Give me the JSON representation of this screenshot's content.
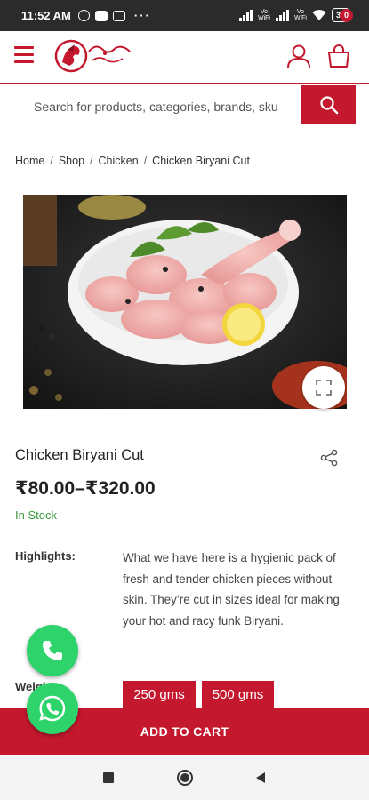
{
  "status_bar": {
    "time": "11:52 AM",
    "dots": "···",
    "volte1": "Vo\nWiFi",
    "volte2": "Vo\nWiFi",
    "battery": "38"
  },
  "header": {
    "logo_alt": "store-logo",
    "cart_count": "0"
  },
  "search": {
    "placeholder": "Search for products, categories, brands, sku"
  },
  "breadcrumb": {
    "items": [
      "Home",
      "Shop",
      "Chicken",
      "Chicken Biryani Cut"
    ],
    "separator": "/"
  },
  "product": {
    "title": "Chicken Biryani Cut",
    "price": "₹80.00–₹320.00",
    "stock": "In Stock",
    "highlights_label": "Highlights:",
    "highlights_text": "What we have here is a hygienic pack of fresh and tender chicken pieces without skin. They’re cut in sizes ideal for making your hot and racy funk Biryani.",
    "weight_label": "Weight",
    "weights": [
      "250 gms",
      "500 gms"
    ],
    "add_to_cart": "ADD TO CART"
  },
  "colors": {
    "brand": "#c4182f",
    "in_stock": "#3b9b3b",
    "whatsapp": "#2fd36b"
  }
}
